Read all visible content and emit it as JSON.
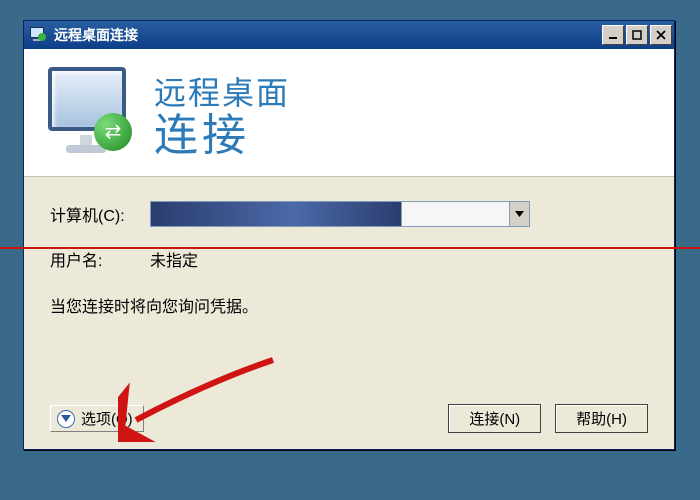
{
  "titlebar": {
    "title": "远程桌面连接"
  },
  "banner": {
    "line1": "远程桌面",
    "line2": "连接"
  },
  "form": {
    "computer_label": "计算机(C):",
    "computer_value": "",
    "username_label": "用户名:",
    "username_value": "未指定",
    "info_text": "当您连接时将向您询问凭据。"
  },
  "buttons": {
    "options": "选项(O)",
    "connect": "连接(N)",
    "help": "帮助(H)"
  },
  "icons": {
    "app": "remote-desktop-icon",
    "minimize": "minimize-icon",
    "maximize": "maximize-icon",
    "close": "close-icon",
    "dropdown": "chevron-down-icon",
    "expand": "chevron-down-circle-icon"
  }
}
